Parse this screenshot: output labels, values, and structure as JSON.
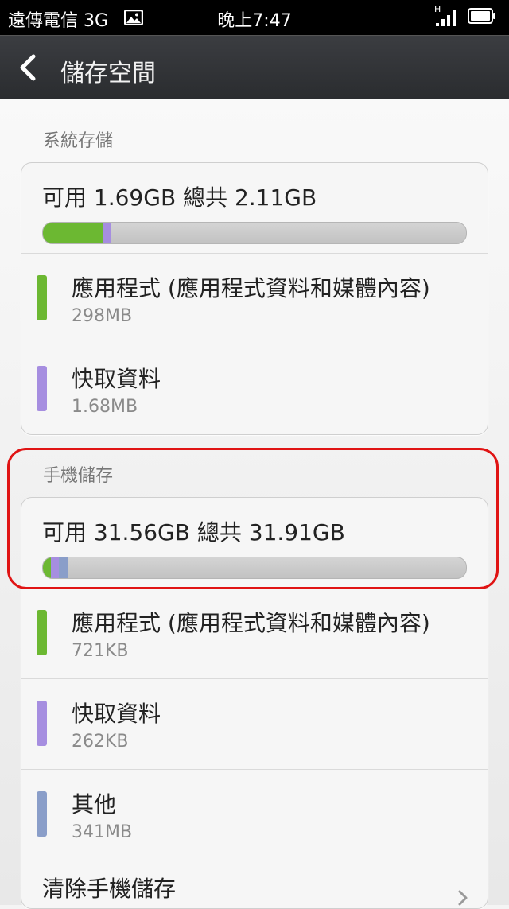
{
  "status_bar": {
    "carrier": "遠傳電信 3G",
    "time": "晚上7:47",
    "network_type": "H"
  },
  "header": {
    "title": "儲存空間"
  },
  "colors": {
    "apps": "#6cb832",
    "cache": "#a68ee0",
    "other": "#8a9ec9",
    "highlight": "#e01414"
  },
  "system_storage": {
    "label": "系統存儲",
    "summary": "可用 1.69GB   總共 2.11GB",
    "usage_fractions": {
      "apps": 0.141,
      "cache": 0.02
    },
    "items": [
      {
        "name": "應用程式 (應用程式資料和媒體內容)",
        "size": "298MB",
        "color_key": "apps"
      },
      {
        "name": "快取資料",
        "size": "1.68MB",
        "color_key": "cache"
      }
    ]
  },
  "phone_storage": {
    "label": "手機儲存",
    "summary": "可用 31.56GB   總共 31.91GB",
    "usage_fractions": {
      "apps": 0.018,
      "cache": 0.02,
      "other": 0.02
    },
    "items": [
      {
        "name": "應用程式 (應用程式資料和媒體內容)",
        "size": "721KB",
        "color_key": "apps"
      },
      {
        "name": "快取資料",
        "size": "262KB",
        "color_key": "cache"
      },
      {
        "name": "其他",
        "size": "341MB",
        "color_key": "other"
      }
    ],
    "clear_action": "清除手機儲存"
  }
}
